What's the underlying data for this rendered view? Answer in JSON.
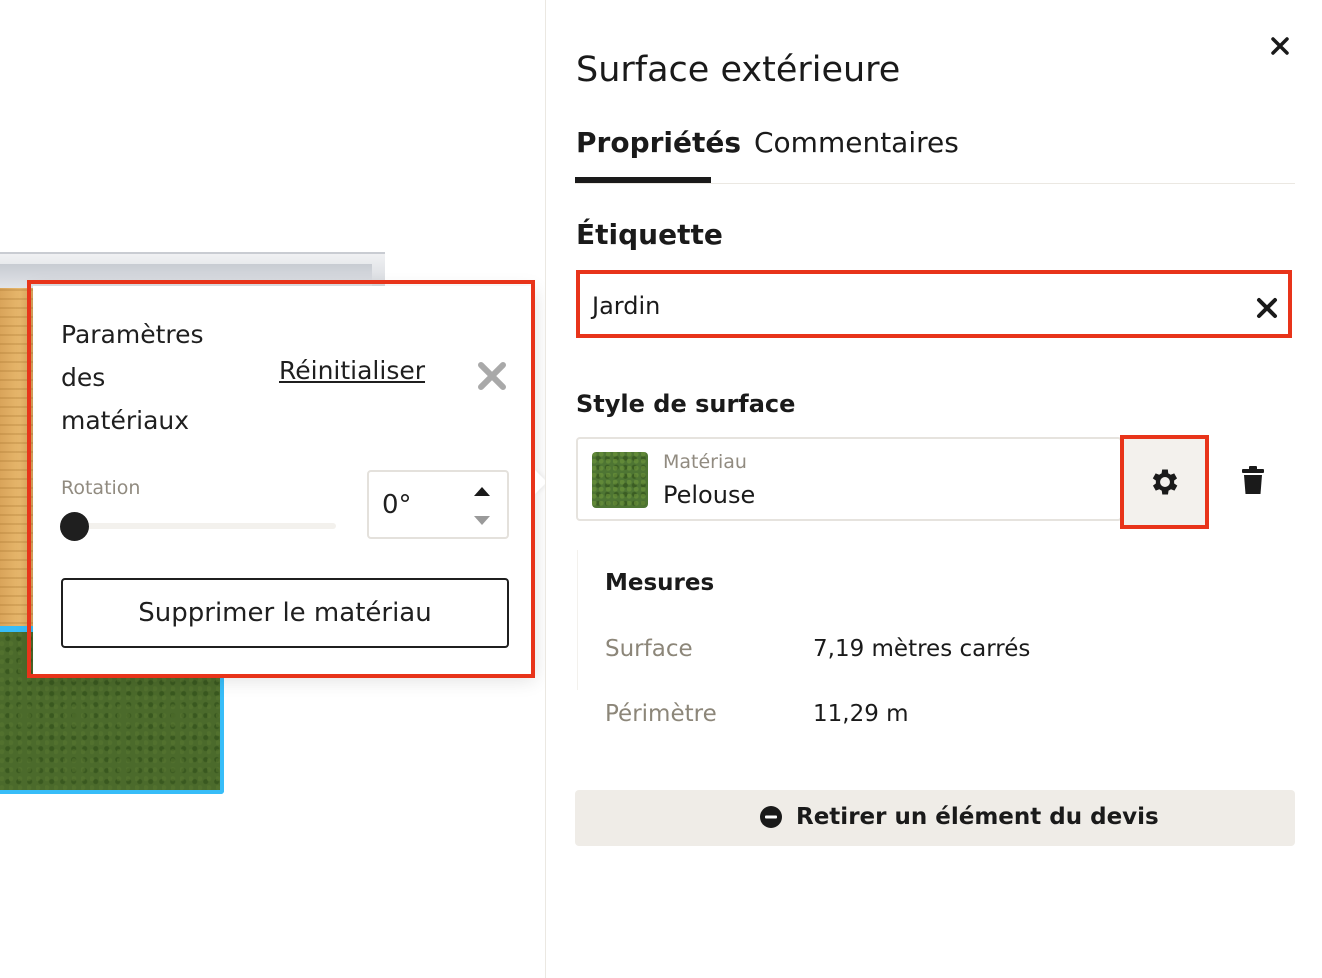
{
  "panel": {
    "title": "Surface extérieure",
    "tabs": [
      {
        "label": "Propriétés",
        "active": true
      },
      {
        "label": "Commentaires",
        "active": false
      }
    ],
    "label_section": {
      "title": "Étiquette",
      "value": "Jardin"
    },
    "surface_style": {
      "title": "Style de surface",
      "material_caption": "Matériau",
      "material_name": "Pelouse"
    },
    "measures": {
      "title": "Mesures",
      "rows": [
        {
          "key": "Surface",
          "value": "7,19 mètres carrés"
        },
        {
          "key": "Périmètre",
          "value": "11,29 m"
        }
      ]
    },
    "remove_button": "Retirer un élément du devis"
  },
  "popover": {
    "title": "Paramètres des matériaux",
    "reset_label": "Réinitialiser",
    "rotation_label": "Rotation",
    "rotation_value": "0°",
    "rotation_level": 0,
    "delete_material_button": "Supprimer le matériau"
  },
  "colors": {
    "highlight": "#e8341a",
    "grass": "#4b6a2b",
    "selection_outline": "#38bdf8"
  },
  "icons": {
    "panel_close": "close-icon",
    "label_clear": "close-icon",
    "popover_close": "close-icon",
    "settings": "gear-icon",
    "trash": "trash-icon",
    "remove": "minus-circle-icon"
  }
}
